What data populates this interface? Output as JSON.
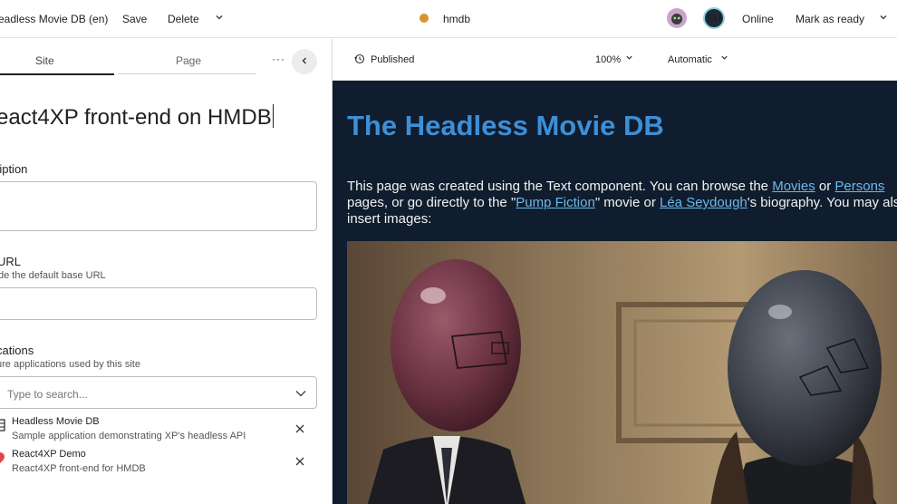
{
  "topbar": {
    "title": "eadless Movie DB (en)",
    "save_label": "Save",
    "delete_label": "Delete",
    "project": "hmdb",
    "user_initials": "SU",
    "status": "Online",
    "mark_ready_label": "Mark as ready"
  },
  "tabs": {
    "site": "Site",
    "page": "Page",
    "more": "···"
  },
  "form": {
    "display_name": "eact4XP front-end on HMDB",
    "description_label": "ription",
    "description_value": "",
    "url_label": "URL",
    "url_help": "de the default base URL",
    "url_value": "",
    "applications_label": "cations",
    "applications_help": "ure applications used by this site",
    "search_placeholder": "Type to search...",
    "applications": [
      {
        "name": "Headless Movie DB",
        "description": "Sample application demonstrating XP's headless API"
      },
      {
        "name": "React4XP Demo",
        "description": "React4XP front-end for HMDB"
      }
    ]
  },
  "preview_toolbar": {
    "status": "Published",
    "zoom": "100%",
    "device": "Automatic"
  },
  "preview": {
    "title": "The Headless Movie DB",
    "text_1": "This page was created using the Text component. You can browse the ",
    "link_movies": "Movies",
    "text_2": " or ",
    "link_persons": "Persons",
    "text_3": " pages, or go directly to the \"",
    "link_pump": "Pump Fiction",
    "text_4": "\" movie or ",
    "link_lea": "Léa Seydough",
    "text_5": "'s biography. You may also insert images:"
  },
  "colors": {
    "accent": "#3d8fd6",
    "preview_bg": "#0f1d2e",
    "online": "#2e9e3e",
    "warning": "#d9922e"
  }
}
